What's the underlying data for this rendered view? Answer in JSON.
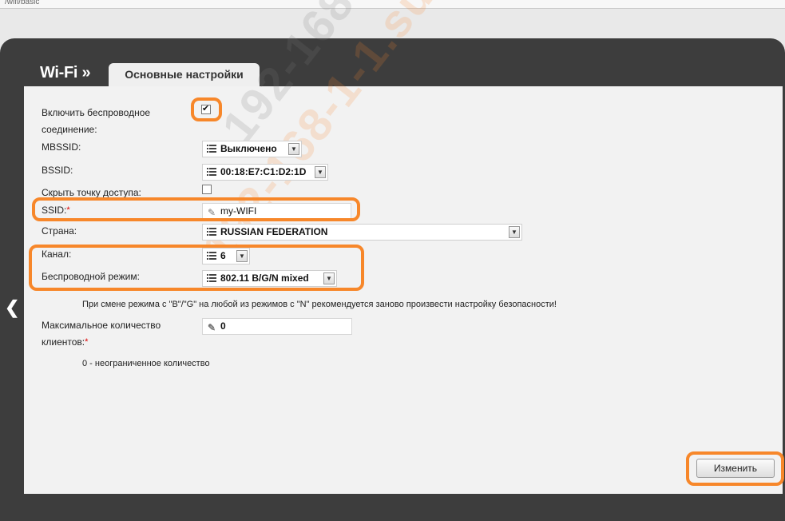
{
  "browser": {
    "url_fragment": "/wifi/basic"
  },
  "header": {
    "crumb": "Wi-Fi »",
    "tab": "Основные настройки"
  },
  "form": {
    "enable_label": "Включить беспроводное соединение:",
    "enable_checked": true,
    "mbssid_label": "MBSSID:",
    "mbssid_value": "Выключено",
    "bssid_label": "BSSID:",
    "bssid_value": "00:18:E7:C1:D2:1D",
    "hide_label": "Скрыть точку доступа:",
    "hide_checked": false,
    "ssid_label": "SSID:",
    "ssid_value": "my-WIFI",
    "country_label": "Страна:",
    "country_value": "RUSSIAN FEDERATION",
    "channel_label": "Канал:",
    "channel_value": "6",
    "mode_label": "Беспроводной режим:",
    "mode_value": "802.11 B/G/N mixed",
    "mode_note": "При смене режима с \"B\"/\"G\" на любой из режимов с \"N\" рекомендуется заново произвести настройку безопасности!",
    "maxclients_label": "Максимальное количество клиентов:",
    "maxclients_value": "0",
    "maxclients_note": "0 - неограниченное количество",
    "required_mark": "*"
  },
  "actions": {
    "apply_label": "Изменить"
  },
  "watermark": "192-168-1-1.su",
  "colors": {
    "highlight": "#f7872a",
    "frame": "#3d3d3d",
    "panel": "#f2f2f2"
  }
}
